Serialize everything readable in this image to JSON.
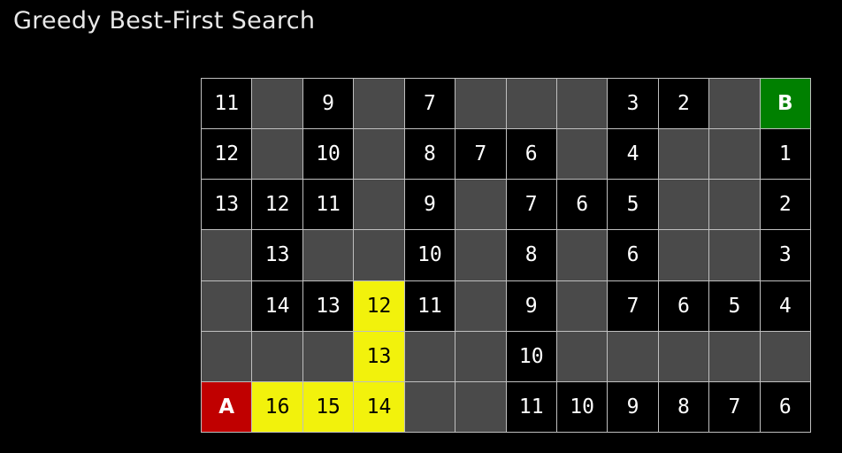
{
  "title": "Greedy Best-First Search",
  "colors": {
    "background": "#000000",
    "wall": "#4a4a4a",
    "open": "#000000",
    "path": "#f2f20c",
    "start": "#c00000",
    "goal": "#008000",
    "grid_line": "#bfbfbf"
  },
  "grid": {
    "rows": 7,
    "cols": 12,
    "cells": [
      [
        {
          "type": "open",
          "label": "11"
        },
        {
          "type": "wall",
          "label": ""
        },
        {
          "type": "open",
          "label": "9"
        },
        {
          "type": "wall",
          "label": ""
        },
        {
          "type": "open",
          "label": "7"
        },
        {
          "type": "wall",
          "label": ""
        },
        {
          "type": "wall",
          "label": ""
        },
        {
          "type": "wall",
          "label": ""
        },
        {
          "type": "open",
          "label": "3"
        },
        {
          "type": "open",
          "label": "2"
        },
        {
          "type": "wall",
          "label": ""
        },
        {
          "type": "goal",
          "label": "B"
        }
      ],
      [
        {
          "type": "open",
          "label": "12"
        },
        {
          "type": "wall",
          "label": ""
        },
        {
          "type": "open",
          "label": "10"
        },
        {
          "type": "wall",
          "label": ""
        },
        {
          "type": "open",
          "label": "8"
        },
        {
          "type": "open",
          "label": "7"
        },
        {
          "type": "open",
          "label": "6"
        },
        {
          "type": "wall",
          "label": ""
        },
        {
          "type": "open",
          "label": "4"
        },
        {
          "type": "wall",
          "label": ""
        },
        {
          "type": "wall",
          "label": ""
        },
        {
          "type": "open",
          "label": "1"
        }
      ],
      [
        {
          "type": "open",
          "label": "13"
        },
        {
          "type": "open",
          "label": "12"
        },
        {
          "type": "open",
          "label": "11"
        },
        {
          "type": "wall",
          "label": ""
        },
        {
          "type": "open",
          "label": "9"
        },
        {
          "type": "wall",
          "label": ""
        },
        {
          "type": "open",
          "label": "7"
        },
        {
          "type": "open",
          "label": "6"
        },
        {
          "type": "open",
          "label": "5"
        },
        {
          "type": "wall",
          "label": ""
        },
        {
          "type": "wall",
          "label": ""
        },
        {
          "type": "open",
          "label": "2"
        }
      ],
      [
        {
          "type": "wall",
          "label": ""
        },
        {
          "type": "open",
          "label": "13"
        },
        {
          "type": "wall",
          "label": ""
        },
        {
          "type": "wall",
          "label": ""
        },
        {
          "type": "open",
          "label": "10"
        },
        {
          "type": "wall",
          "label": ""
        },
        {
          "type": "open",
          "label": "8"
        },
        {
          "type": "wall",
          "label": ""
        },
        {
          "type": "open",
          "label": "6"
        },
        {
          "type": "wall",
          "label": ""
        },
        {
          "type": "wall",
          "label": ""
        },
        {
          "type": "open",
          "label": "3"
        }
      ],
      [
        {
          "type": "wall",
          "label": ""
        },
        {
          "type": "open",
          "label": "14"
        },
        {
          "type": "open",
          "label": "13"
        },
        {
          "type": "path",
          "label": "12"
        },
        {
          "type": "open",
          "label": "11"
        },
        {
          "type": "wall",
          "label": ""
        },
        {
          "type": "open",
          "label": "9"
        },
        {
          "type": "wall",
          "label": ""
        },
        {
          "type": "open",
          "label": "7"
        },
        {
          "type": "open",
          "label": "6"
        },
        {
          "type": "open",
          "label": "5"
        },
        {
          "type": "open",
          "label": "4"
        }
      ],
      [
        {
          "type": "wall",
          "label": ""
        },
        {
          "type": "wall",
          "label": ""
        },
        {
          "type": "wall",
          "label": ""
        },
        {
          "type": "path",
          "label": "13"
        },
        {
          "type": "wall",
          "label": ""
        },
        {
          "type": "wall",
          "label": ""
        },
        {
          "type": "open",
          "label": "10"
        },
        {
          "type": "wall",
          "label": ""
        },
        {
          "type": "wall",
          "label": ""
        },
        {
          "type": "wall",
          "label": ""
        },
        {
          "type": "wall",
          "label": ""
        },
        {
          "type": "wall",
          "label": ""
        }
      ],
      [
        {
          "type": "start",
          "label": "A"
        },
        {
          "type": "path",
          "label": "16"
        },
        {
          "type": "path",
          "label": "15"
        },
        {
          "type": "path",
          "label": "14"
        },
        {
          "type": "wall",
          "label": ""
        },
        {
          "type": "wall",
          "label": ""
        },
        {
          "type": "open",
          "label": "11"
        },
        {
          "type": "open",
          "label": "10"
        },
        {
          "type": "open",
          "label": "9"
        },
        {
          "type": "open",
          "label": "8"
        },
        {
          "type": "open",
          "label": "7"
        },
        {
          "type": "open",
          "label": "6"
        }
      ]
    ]
  }
}
